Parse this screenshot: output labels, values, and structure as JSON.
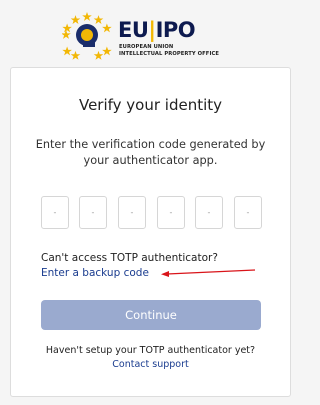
{
  "logo": {
    "brand_main": "EU",
    "brand_rest": "IPO",
    "line1": "EUROPEAN UNION",
    "line2": "INTELLECTUAL PROPERTY OFFICE"
  },
  "card": {
    "title": "Verify your identity",
    "instructions": "Enter the verification code generated by your authenticator app.",
    "otp_placeholders": [
      "-",
      "-",
      "-",
      "-",
      "-",
      "-"
    ],
    "cant_access": "Can't access TOTP authenticator?",
    "backup_link": "Enter a backup code",
    "continue_label": "Continue",
    "no_setup": "Haven't setup your TOTP authenticator yet?",
    "support_link": "Contact support"
  },
  "colors": {
    "background": "#f5f5f5",
    "brand_navy": "#0d1a4f",
    "brand_gold": "#f2b705",
    "link": "#1a3c8f",
    "button_disabled": "#9aaacf",
    "annotation_arrow": "#d9141a"
  }
}
